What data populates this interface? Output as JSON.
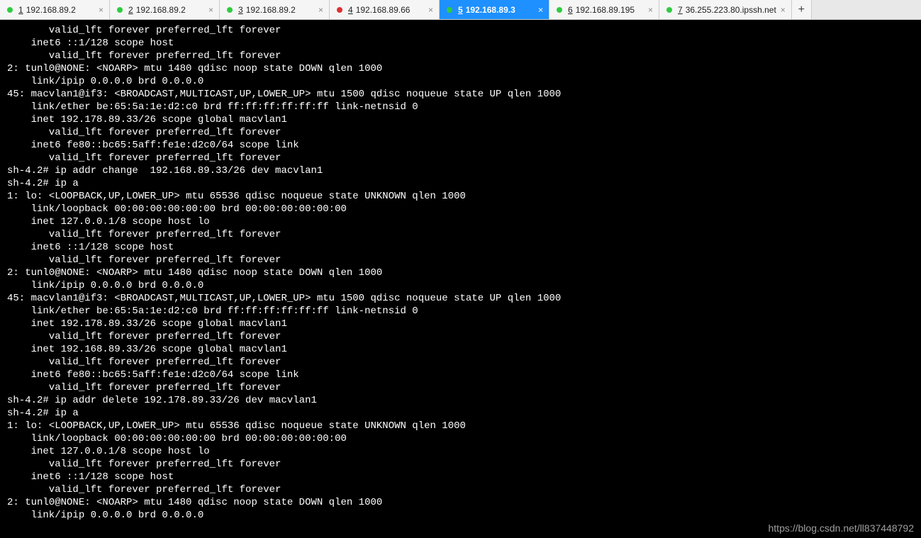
{
  "tabs": [
    {
      "num": "1",
      "label": "192.168.89.2",
      "dot": "green",
      "active": false
    },
    {
      "num": "2",
      "label": "192.168.89.2",
      "dot": "green",
      "active": false
    },
    {
      "num": "3",
      "label": "192.168.89.2",
      "dot": "green",
      "active": false
    },
    {
      "num": "4",
      "label": "192.168.89.66",
      "dot": "red",
      "active": false
    },
    {
      "num": "5",
      "label": "192.168.89.3",
      "dot": "green",
      "active": true
    },
    {
      "num": "6",
      "label": "192.168.89.195",
      "dot": "green",
      "active": false
    },
    {
      "num": "7",
      "label": "36.255.223.80.ipssh.net",
      "dot": "green",
      "active": false
    }
  ],
  "new_tab_label": "+",
  "close_glyph": "×",
  "terminal_lines": [
    "       valid_lft forever preferred_lft forever",
    "    inet6 ::1/128 scope host ",
    "       valid_lft forever preferred_lft forever",
    "2: tunl0@NONE: <NOARP> mtu 1480 qdisc noop state DOWN qlen 1000",
    "    link/ipip 0.0.0.0 brd 0.0.0.0",
    "45: macvlan1@if3: <BROADCAST,MULTICAST,UP,LOWER_UP> mtu 1500 qdisc noqueue state UP qlen 1000",
    "    link/ether be:65:5a:1e:d2:c0 brd ff:ff:ff:ff:ff:ff link-netnsid 0",
    "    inet 192.178.89.33/26 scope global macvlan1",
    "       valid_lft forever preferred_lft forever",
    "    inet6 fe80::bc65:5aff:fe1e:d2c0/64 scope link ",
    "       valid_lft forever preferred_lft forever",
    "sh-4.2# ip addr change  192.168.89.33/26 dev macvlan1",
    "sh-4.2# ip a",
    "1: lo: <LOOPBACK,UP,LOWER_UP> mtu 65536 qdisc noqueue state UNKNOWN qlen 1000",
    "    link/loopback 00:00:00:00:00:00 brd 00:00:00:00:00:00",
    "    inet 127.0.0.1/8 scope host lo",
    "       valid_lft forever preferred_lft forever",
    "    inet6 ::1/128 scope host ",
    "       valid_lft forever preferred_lft forever",
    "2: tunl0@NONE: <NOARP> mtu 1480 qdisc noop state DOWN qlen 1000",
    "    link/ipip 0.0.0.0 brd 0.0.0.0",
    "45: macvlan1@if3: <BROADCAST,MULTICAST,UP,LOWER_UP> mtu 1500 qdisc noqueue state UP qlen 1000",
    "    link/ether be:65:5a:1e:d2:c0 brd ff:ff:ff:ff:ff:ff link-netnsid 0",
    "    inet 192.178.89.33/26 scope global macvlan1",
    "       valid_lft forever preferred_lft forever",
    "    inet 192.168.89.33/26 scope global macvlan1",
    "       valid_lft forever preferred_lft forever",
    "    inet6 fe80::bc65:5aff:fe1e:d2c0/64 scope link ",
    "       valid_lft forever preferred_lft forever",
    "sh-4.2# ip addr delete 192.178.89.33/26 dev macvlan1",
    "sh-4.2# ip a",
    "1: lo: <LOOPBACK,UP,LOWER_UP> mtu 65536 qdisc noqueue state UNKNOWN qlen 1000",
    "    link/loopback 00:00:00:00:00:00 brd 00:00:00:00:00:00",
    "    inet 127.0.0.1/8 scope host lo",
    "       valid_lft forever preferred_lft forever",
    "    inet6 ::1/128 scope host ",
    "       valid_lft forever preferred_lft forever",
    "2: tunl0@NONE: <NOARP> mtu 1480 qdisc noop state DOWN qlen 1000",
    "    link/ipip 0.0.0.0 brd 0.0.0.0"
  ],
  "watermark": "https://blog.csdn.net/ll837448792"
}
